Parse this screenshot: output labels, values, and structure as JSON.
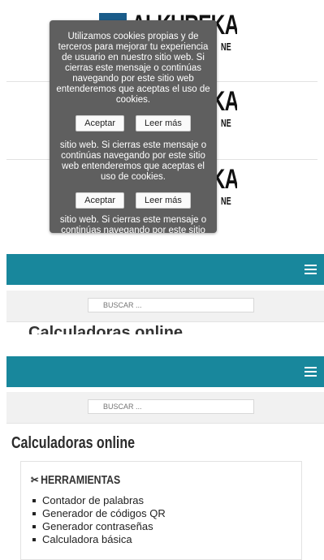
{
  "logo": {
    "word": "ALKUREKA",
    "sub": "NE"
  },
  "cookie": {
    "message": "Utilizamos cookies propias y de terceros para mejorar tu experiencia de usuario en nuestro sitio web. Si cierras este mensaje o continúas navegando por este sitio web entenderemos que aceptas el uso de cookies.",
    "message_repeat": "sitio web. Si cierras este mensaje o continúas navegando por este sitio web entenderemos que aceptas el uso de cookies.",
    "message_tail": "sitio web. Si cierras este mensaje o continúas navegando por este sitio",
    "accept_label": "Aceptar",
    "more_label": "Leer más"
  },
  "search": {
    "placeholder": "BUSCAR ..."
  },
  "cut_title": "Calculadoras online",
  "main": {
    "title": "Calculadoras online"
  },
  "tools": {
    "heading": "HERRAMIENTAS",
    "icon": "scissors-icon",
    "items": [
      {
        "label": "Contador de palabras"
      },
      {
        "label": "Generador de códigos QR"
      },
      {
        "label": "Generador contraseñas"
      },
      {
        "label": "Calculadora básica"
      }
    ]
  },
  "colors": {
    "nav": "#18879c",
    "cookie_bg": "#5f5f5f"
  }
}
